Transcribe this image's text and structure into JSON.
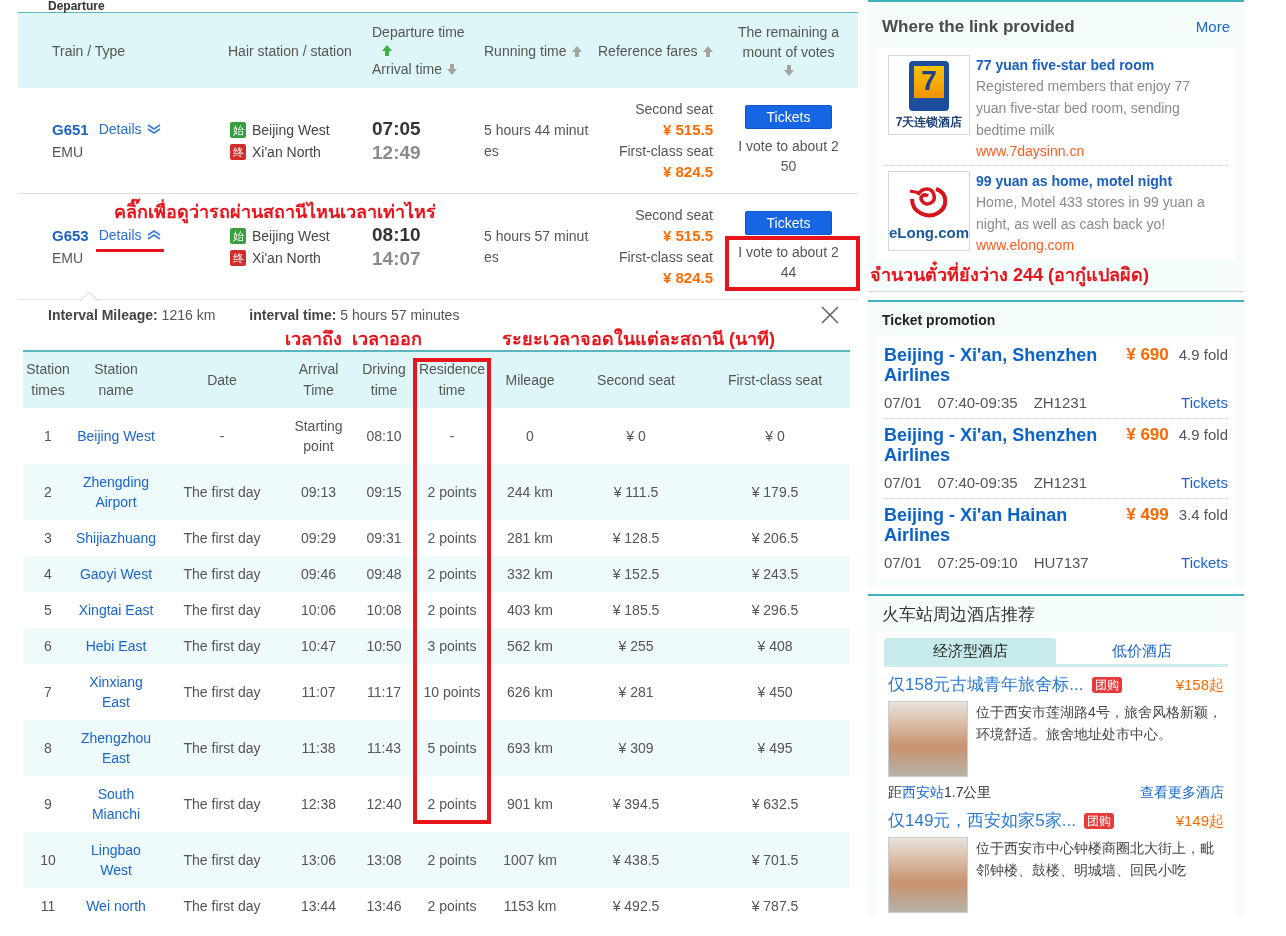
{
  "section_title": "Departure",
  "train_table": {
    "columns": [
      {
        "lines": [
          {
            "label": "Train / Type"
          }
        ]
      },
      {
        "lines": [
          {
            "label": "Hair station / station"
          }
        ]
      },
      {
        "lines": [
          {
            "label": "Departure time",
            "ascending": true,
            "active": true
          },
          {
            "label": "Arrival time",
            "ascending": false,
            "active": false
          }
        ]
      },
      {
        "lines": [
          {
            "label": "Running time",
            "ascending": true,
            "active": false
          }
        ]
      },
      {
        "lines": [
          {
            "label": "Reference fares",
            "ascending": true,
            "active": false
          }
        ]
      },
      {
        "lines": [
          {
            "label": "The remaining amount of votes",
            "ascending": false,
            "active": false
          }
        ]
      }
    ],
    "trains": [
      {
        "code": "G651",
        "details": "Details",
        "expanded": false,
        "details_marked": false,
        "type": "EMU",
        "from_tag": "始",
        "from": "Beijing West",
        "to_tag": "终",
        "to": "Xi'an North",
        "departure": "07:05",
        "arrival": "12:49",
        "duration": "5 hours 44 minutes",
        "fares": [
          {
            "label": "Second seat",
            "price": "¥ 515.5"
          },
          {
            "label": "First-class seat",
            "price": "¥ 824.5"
          }
        ],
        "button": "Tickets",
        "votes": "I vote to about 250",
        "votes_marked": false
      },
      {
        "code": "G653",
        "details": "Details",
        "expanded": true,
        "details_marked": true,
        "note": "คลิ๊กเพื่อดูว่ารถผ่านสถานีไหนเวลาเท่าไหร่",
        "type": "EMU",
        "from_tag": "始",
        "from": "Beijing West",
        "to_tag": "终",
        "to": "Xi'an North",
        "departure": "08:10",
        "arrival": "14:07",
        "duration": "5 hours 57 minutes",
        "fares": [
          {
            "label": "Second seat",
            "price": "¥ 515.5"
          },
          {
            "label": "First-class seat",
            "price": "¥ 824.5"
          }
        ],
        "button": "Tickets",
        "votes": "I vote to about 244",
        "votes_marked": true,
        "votes_note": "จำนวนตั๋วที่ยังว่าง 244 (อากู๋แปลผิด)"
      }
    ]
  },
  "stop_panel": {
    "summary": [
      "**Interval Mileage:** 1216 km",
      "**interval time:** 5 hours 57 minutes"
    ],
    "columns": [
      {
        "label": "Station times",
        "kind": "text",
        "marked": false
      },
      {
        "label": "Station name",
        "kind": "link",
        "marked": false
      },
      {
        "label": "Date",
        "kind": "text",
        "marked": false
      },
      {
        "label": "Arrival Time",
        "kind": "text",
        "marked": false,
        "note": "เวลาถึง"
      },
      {
        "label": "Driving time",
        "kind": "text",
        "marked": false,
        "note": "เวลาออก"
      },
      {
        "label": "Residence time",
        "kind": "text",
        "marked": true,
        "note": "ระยะเวลาจอดในแต่ละสถานี (นาที)"
      },
      {
        "label": "Mileage",
        "kind": "text",
        "marked": false
      },
      {
        "label": "Second seat",
        "kind": "text",
        "marked": false
      },
      {
        "label": "First-class seat",
        "kind": "text",
        "marked": false
      }
    ],
    "rows": [
      {
        "cells": [
          "1",
          "Beijing West",
          "-",
          "Starting point",
          "08:10",
          "-",
          "0",
          "¥ 0",
          "¥ 0"
        ],
        "marked": true
      },
      {
        "cells": [
          "2",
          "Zhengding Airport",
          "The first day",
          "09:13",
          "09:15",
          "2 points",
          "244 km",
          "¥ 111.5",
          "¥ 179.5"
        ],
        "marked": true
      },
      {
        "cells": [
          "3",
          "Shijiazhuang",
          "The first day",
          "09:29",
          "09:31",
          "2 points",
          "281 km",
          "¥ 128.5",
          "¥ 206.5"
        ],
        "marked": true
      },
      {
        "cells": [
          "4",
          "Gaoyi West",
          "The first day",
          "09:46",
          "09:48",
          "2 points",
          "332 km",
          "¥ 152.5",
          "¥ 243.5"
        ],
        "marked": true
      },
      {
        "cells": [
          "5",
          "Xingtai East",
          "The first day",
          "10:06",
          "10:08",
          "2 points",
          "403 km",
          "¥ 185.5",
          "¥ 296.5"
        ],
        "marked": true
      },
      {
        "cells": [
          "6",
          "Hebi East",
          "The first day",
          "10:47",
          "10:50",
          "3 points",
          "562 km",
          "¥ 255",
          "¥ 408"
        ],
        "marked": true
      },
      {
        "cells": [
          "7",
          "Xinxiang East",
          "The first day",
          "11:07",
          "11:17",
          "10 points",
          "626 km",
          "¥ 281",
          "¥ 450"
        ],
        "marked": true
      },
      {
        "cells": [
          "8",
          "Zhengzhou East",
          "The first day",
          "11:38",
          "11:43",
          "5 points",
          "693 km",
          "¥ 309",
          "¥ 495"
        ],
        "marked": true
      },
      {
        "cells": [
          "9",
          "South Mianchi",
          "The first day",
          "12:38",
          "12:40",
          "2 points",
          "901 km",
          "¥ 394.5",
          "¥ 632.5"
        ],
        "marked": true
      },
      {
        "cells": [
          "10",
          "Lingbao West",
          "The first day",
          "13:06",
          "13:08",
          "2 points",
          "1007 km",
          "¥ 438.5",
          "¥ 701.5"
        ],
        "marked": false
      },
      {
        "cells": [
          "11",
          "Wei north",
          "The first day",
          "13:44",
          "13:46",
          "2 points",
          "1153 km",
          "¥ 492.5",
          "¥ 787.5"
        ],
        "marked": false
      }
    ]
  },
  "sidebar": {
    "links": {
      "title": "Where the link provided",
      "more": "More",
      "ads": [
        {
          "logo": {
            "kind": "tile",
            "mark": "7",
            "caption": "7天连锁酒店"
          },
          "title": "77 yuan five-star bed room",
          "desc": "Registered members that enjoy 77 yuan five-star bed room, sending bedtime milk",
          "url": "www.7daysinn.cn"
        },
        {
          "logo": {
            "kind": "swirl",
            "caption": "eLong.com"
          },
          "title": "99 yuan as home, motel night",
          "desc": "Home, Motel 433 stores in 99 yuan a night, as well as cash back yo!",
          "url": "www.elong.com"
        }
      ]
    },
    "promotion": {
      "title": "Ticket promotion",
      "deals": [
        {
          "route": "Beijing - Xi'an, Shenzhen Airlines",
          "price": "¥ 690",
          "discount": "4.9 fold",
          "date": "07/01",
          "time": "07:40-09:35",
          "flight": "ZH1231",
          "link": "Tickets"
        },
        {
          "route": "Beijing - Xi'an, Shenzhen Airlines",
          "price": "¥ 690",
          "discount": "4.9 fold",
          "date": "07/01",
          "time": "07:40-09:35",
          "flight": "ZH1231",
          "link": "Tickets"
        },
        {
          "route": "Beijing - Xi'an Hainan Airlines",
          "price": "¥ 499",
          "discount": "3.4 fold",
          "date": "07/01",
          "time": "07:25-09:10",
          "flight": "HU7137",
          "link": "Tickets"
        }
      ]
    },
    "hotels": {
      "title": "火车站周边酒店推荐",
      "tabs": [
        {
          "label": "经济型酒店",
          "selected": true
        },
        {
          "label": "低价酒店",
          "selected": false
        }
      ],
      "items": [
        {
          "title": "仅158元古城青年旅舍标...",
          "tag": "团购",
          "price": "¥158起",
          "desc": "位于西安市莲湖路4号，旅舍风格新颖，环境舒适。旅舍地址处市中心。",
          "distance": {
            "prefix": "距",
            "link": "西安站",
            "suffix": "1.7公里"
          },
          "more": "查看更多酒店"
        },
        {
          "title": "仅149元，西安如家5家...",
          "tag": "团购",
          "price": "¥149起",
          "desc": "位于西安市中心钟楼商圈北大街上，毗邻钟楼、鼓楼、明城墙、回民小吃"
        }
      ]
    }
  }
}
